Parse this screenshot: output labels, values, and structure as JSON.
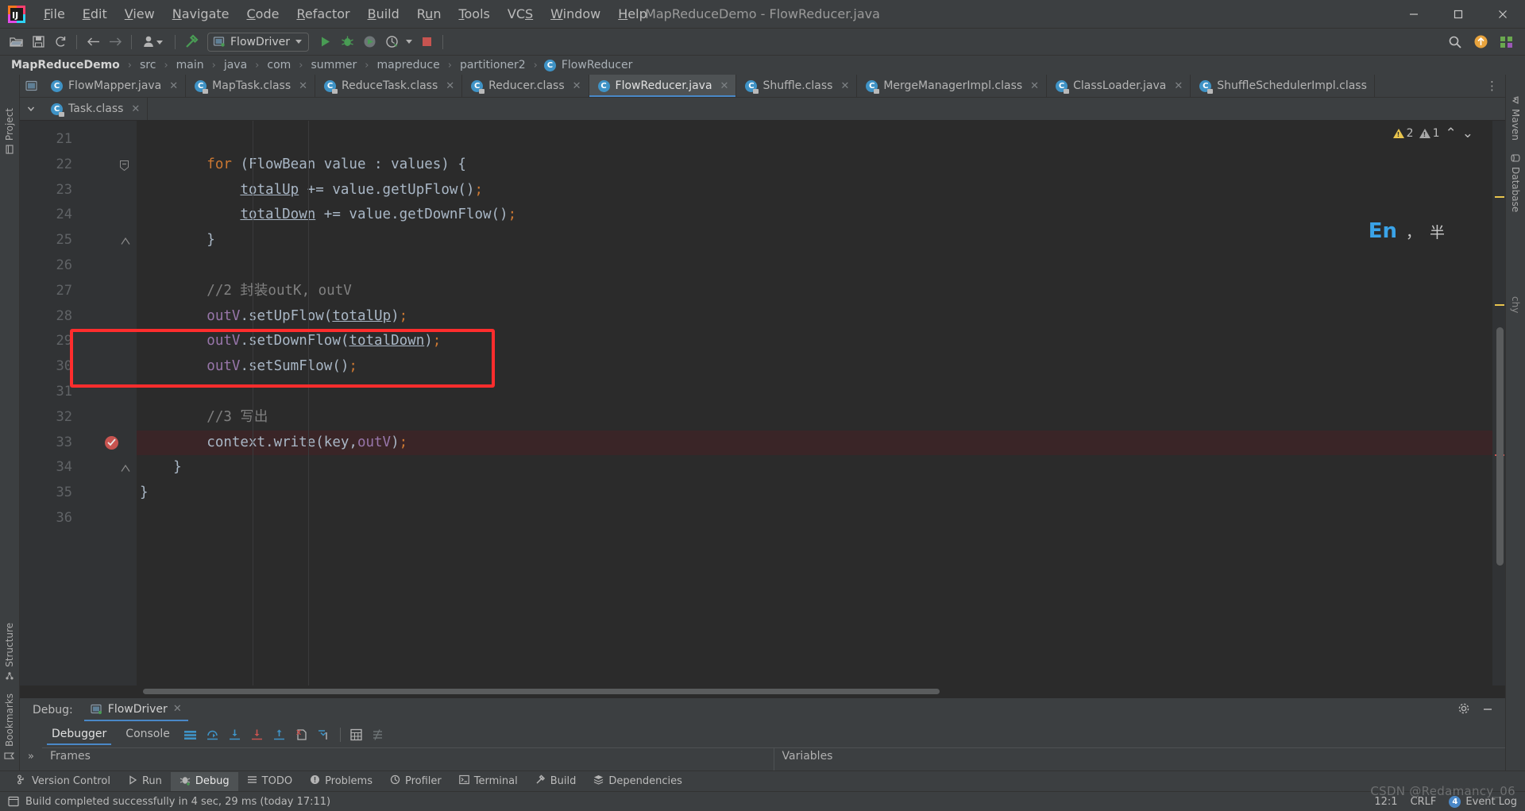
{
  "window": {
    "title": "MapReduceDemo - FlowReducer.java",
    "minimize_label": "─",
    "maximize_label": "❐",
    "close_label": "✕"
  },
  "menu": {
    "items": [
      {
        "label": "File",
        "mnemonic": "F"
      },
      {
        "label": "Edit",
        "mnemonic": "E"
      },
      {
        "label": "View",
        "mnemonic": "V"
      },
      {
        "label": "Navigate",
        "mnemonic": "N"
      },
      {
        "label": "Code",
        "mnemonic": "C"
      },
      {
        "label": "Refactor",
        "mnemonic": "R"
      },
      {
        "label": "Build",
        "mnemonic": "B"
      },
      {
        "label": "Run",
        "mnemonic": "u"
      },
      {
        "label": "Tools",
        "mnemonic": "T"
      },
      {
        "label": "VCS",
        "mnemonic": "S"
      },
      {
        "label": "Window",
        "mnemonic": "W"
      },
      {
        "label": "Help",
        "mnemonic": "H"
      }
    ]
  },
  "toolbar": {
    "open_icon": "open-folder-icon",
    "save_icon": "save-icon",
    "sync_icon": "sync-icon",
    "back_icon": "back-arrow-icon",
    "forward_icon": "forward-arrow-icon",
    "vcs_icon": "vcs-user-icon",
    "build_icon": "build-hammer-icon",
    "run_config": "FlowDriver",
    "run_icon": "run-icon",
    "debug_icon": "debug-icon",
    "coverage_icon": "run-with-coverage-icon",
    "profiler_icon": "profiler-icon",
    "stop_icon": "stop-icon",
    "search_icon": "search-everywhere-icon",
    "updates_icon": "updates-icon",
    "ide_icon": "ide-icon"
  },
  "breadcrumb": {
    "items": [
      "MapReduceDemo",
      "src",
      "main",
      "java",
      "com",
      "summer",
      "mapreduce",
      "partitioner2",
      "FlowReducer"
    ],
    "separator": "›"
  },
  "editor_tabs": {
    "row1": [
      {
        "label": "FlowMapper.java",
        "icon": "java-class-icon",
        "active": false,
        "locked": false
      },
      {
        "label": "MapTask.class",
        "icon": "java-class-icon",
        "active": false,
        "locked": true
      },
      {
        "label": "ReduceTask.class",
        "icon": "java-class-icon",
        "active": false,
        "locked": true
      },
      {
        "label": "Reducer.class",
        "icon": "java-class-icon",
        "active": false,
        "locked": true
      },
      {
        "label": "FlowReducer.java",
        "icon": "java-class-icon",
        "active": true,
        "locked": false
      },
      {
        "label": "Shuffle.class",
        "icon": "java-class-icon",
        "active": false,
        "locked": true
      },
      {
        "label": "MergeManagerImpl.class",
        "icon": "java-class-icon",
        "active": false,
        "locked": true
      },
      {
        "label": "ClassLoader.java",
        "icon": "java-class-icon",
        "active": false,
        "locked": true
      },
      {
        "label": "ShuffleSchedulerImpl.class",
        "icon": "java-class-icon",
        "active": false,
        "locked": true
      }
    ],
    "row2": [
      {
        "label": "Task.class",
        "icon": "java-class-icon",
        "active": false,
        "locked": true
      }
    ],
    "more_label": "⋮",
    "close_glyph": "✕"
  },
  "left_rail": {
    "items": [
      {
        "label": "Project",
        "icon": "project-icon"
      },
      {
        "label": "Structure",
        "icon": "structure-icon"
      },
      {
        "label": "Bookmarks",
        "icon": "bookmarks-icon"
      }
    ]
  },
  "right_rail": {
    "items": [
      {
        "label": "Maven",
        "icon": "maven-icon"
      },
      {
        "label": "Database",
        "icon": "database-icon"
      }
    ]
  },
  "inspections": {
    "warning_count": "2",
    "weak_warning_count": "1",
    "up_glyph": "⌃",
    "down_glyph": "⌄"
  },
  "code": {
    "first_line": 21,
    "lines": [
      {
        "n": 21,
        "tokens": [],
        "fold": null,
        "highlight": false,
        "breakpoint": false
      },
      {
        "n": 22,
        "tokens": [
          {
            "t": "        ",
            "c": "pl"
          },
          {
            "t": "for",
            "c": "kw"
          },
          {
            "t": " (FlowBean value : values) {",
            "c": "pl"
          }
        ],
        "fold": "open",
        "highlight": false,
        "breakpoint": false
      },
      {
        "n": 23,
        "tokens": [
          {
            "t": "            ",
            "c": "pl"
          },
          {
            "t": "totalUp",
            "c": "loc"
          },
          {
            "t": " += value.getUpFlow()",
            "c": "pl"
          },
          {
            "t": ";",
            "c": "sem"
          }
        ],
        "fold": null,
        "highlight": false,
        "breakpoint": false
      },
      {
        "n": 24,
        "tokens": [
          {
            "t": "            ",
            "c": "pl"
          },
          {
            "t": "totalDown",
            "c": "loc"
          },
          {
            "t": " += value.getDownFlow()",
            "c": "pl"
          },
          {
            "t": ";",
            "c": "sem"
          }
        ],
        "fold": null,
        "highlight": false,
        "breakpoint": false
      },
      {
        "n": 25,
        "tokens": [
          {
            "t": "        }",
            "c": "pl"
          }
        ],
        "fold": "close",
        "highlight": false,
        "breakpoint": false
      },
      {
        "n": 26,
        "tokens": [],
        "fold": null,
        "highlight": false,
        "breakpoint": false
      },
      {
        "n": 27,
        "tokens": [
          {
            "t": "        //2 封装outK, outV",
            "c": "cmt"
          }
        ],
        "fold": null,
        "highlight": false,
        "breakpoint": false
      },
      {
        "n": 28,
        "tokens": [
          {
            "t": "        ",
            "c": "pl"
          },
          {
            "t": "outV",
            "c": "fld"
          },
          {
            "t": ".setUpFlow(",
            "c": "pl"
          },
          {
            "t": "totalUp",
            "c": "loc"
          },
          {
            "t": ")",
            "c": "pl"
          },
          {
            "t": ";",
            "c": "sem"
          }
        ],
        "fold": null,
        "highlight": false,
        "breakpoint": false
      },
      {
        "n": 29,
        "tokens": [
          {
            "t": "        ",
            "c": "pl"
          },
          {
            "t": "outV",
            "c": "fld"
          },
          {
            "t": ".setDownFlow(",
            "c": "pl"
          },
          {
            "t": "totalDown",
            "c": "loc"
          },
          {
            "t": ")",
            "c": "pl"
          },
          {
            "t": ";",
            "c": "sem"
          }
        ],
        "fold": null,
        "highlight": false,
        "breakpoint": false
      },
      {
        "n": 30,
        "tokens": [
          {
            "t": "        ",
            "c": "pl"
          },
          {
            "t": "outV",
            "c": "fld"
          },
          {
            "t": ".setSumFlow()",
            "c": "pl"
          },
          {
            "t": ";",
            "c": "sem"
          }
        ],
        "fold": null,
        "highlight": false,
        "breakpoint": false
      },
      {
        "n": 31,
        "tokens": [],
        "fold": null,
        "highlight": false,
        "breakpoint": false
      },
      {
        "n": 32,
        "tokens": [
          {
            "t": "        //3 写出",
            "c": "cmt"
          }
        ],
        "fold": null,
        "highlight": false,
        "breakpoint": false
      },
      {
        "n": 33,
        "tokens": [
          {
            "t": "        context.write(key,",
            "c": "pl"
          },
          {
            "t": "outV",
            "c": "fld"
          },
          {
            "t": ")",
            "c": "pl"
          },
          {
            "t": ";",
            "c": "sem"
          }
        ],
        "fold": null,
        "highlight": true,
        "breakpoint": true
      },
      {
        "n": 34,
        "tokens": [
          {
            "t": "    }",
            "c": "pl"
          }
        ],
        "fold": "close",
        "highlight": false,
        "breakpoint": false
      },
      {
        "n": 35,
        "tokens": [
          {
            "t": "}",
            "c": "pl"
          }
        ],
        "fold": null,
        "highlight": false,
        "breakpoint": false
      },
      {
        "n": 36,
        "tokens": [],
        "fold": null,
        "highlight": false,
        "breakpoint": false
      }
    ],
    "annotation": {
      "type": "red-rectangle",
      "target_line": 33
    }
  },
  "ime": {
    "mode": "En",
    "punct": "，",
    "currency": "半",
    "side_label": "chy"
  },
  "debug_panel": {
    "label": "Debug:",
    "session": "FlowDriver",
    "close_glyph": "✕",
    "settings_icon": "gear-icon",
    "minimize_icon": "minimize-icon",
    "tabs": [
      {
        "label": "Debugger",
        "active": true
      },
      {
        "label": "Console",
        "active": false
      }
    ],
    "actions": [
      "layout-icon",
      "step-over-icon",
      "step-into-icon",
      "force-step-into-icon",
      "step-out-icon",
      "drop-frame-icon",
      "run-to-cursor-icon",
      "evaluate-icon",
      "mute-breakpoints-icon"
    ],
    "columns": [
      {
        "title": "Frames"
      },
      {
        "title": "Variables"
      }
    ],
    "expand_glyph": "»"
  },
  "bottom_bar": {
    "items": [
      {
        "label": "Version Control",
        "icon": "branch-icon",
        "active": false
      },
      {
        "label": "Run",
        "icon": "run-icon",
        "active": false
      },
      {
        "label": "Debug",
        "icon": "debug-icon",
        "active": true
      },
      {
        "label": "TODO",
        "icon": "todo-icon",
        "active": false
      },
      {
        "label": "Problems",
        "icon": "problems-icon",
        "active": false
      },
      {
        "label": "Profiler",
        "icon": "profiler-icon",
        "active": false
      },
      {
        "label": "Terminal",
        "icon": "terminal-icon",
        "active": false
      },
      {
        "label": "Build",
        "icon": "build-hammer-icon",
        "active": false
      },
      {
        "label": "Dependencies",
        "icon": "dependencies-icon",
        "active": false
      }
    ]
  },
  "status_bar": {
    "message": "Build completed successfully in 4 sec, 29 ms (today 17:11)",
    "message_icon": "build-status-icon",
    "caret_position": "12:1",
    "encoding": "CRLF",
    "event_log": "Event Log",
    "event_log_count": "4"
  },
  "watermark": "CSDN @Redamancy_06",
  "colors": {
    "accent": "#4a88c7",
    "editor_bg": "#2b2b2b",
    "panel_bg": "#3c3f41",
    "gutter_bg": "#313335",
    "annotation_red": "#ff2d2d",
    "highlight_line": "#3a2527",
    "breakpoint": "#c75450",
    "run_green": "#499c54",
    "stop_red": "#c75450",
    "keyword": "#cc7832",
    "field": "#9876aa",
    "comment": "#808080",
    "text": "#a9b7c6"
  }
}
